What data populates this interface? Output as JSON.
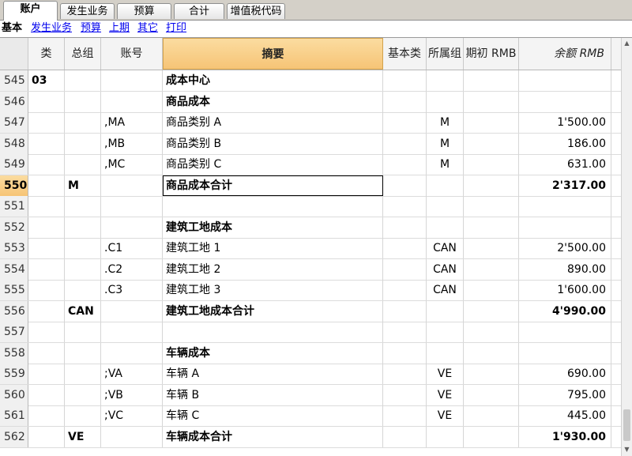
{
  "tabs": [
    {
      "label": "账户"
    },
    {
      "label": "发生业务"
    },
    {
      "label": "预算"
    },
    {
      "label": "合计"
    },
    {
      "label": "增值税代码"
    }
  ],
  "subnav": {
    "current": "基本",
    "links": [
      "发生业务",
      "预算",
      "上期",
      "其它",
      "打印"
    ]
  },
  "columns": [
    "类",
    "总组",
    "账号",
    "摘要",
    "基本类",
    "所属组",
    "期初 RMB",
    "余额 RMB"
  ],
  "rows": [
    {
      "num": "545",
      "cls": "03",
      "group": "",
      "acct": "",
      "desc": "成本中心",
      "base": "",
      "gr": "",
      "open": "",
      "bal": "",
      "bold": true
    },
    {
      "num": "546",
      "cls": "",
      "group": "",
      "acct": "",
      "desc": "商品成本",
      "base": "",
      "gr": "",
      "open": "",
      "bal": "",
      "bold": true
    },
    {
      "num": "547",
      "cls": "",
      "group": "",
      "acct": ",MA",
      "desc": "商品类别 A",
      "base": "",
      "gr": "M",
      "open": "",
      "bal": "1'500.00",
      "bold": false
    },
    {
      "num": "548",
      "cls": "",
      "group": "",
      "acct": ",MB",
      "desc": "商品类别 B",
      "base": "",
      "gr": "M",
      "open": "",
      "bal": "186.00",
      "bold": false
    },
    {
      "num": "549",
      "cls": "",
      "group": "",
      "acct": ",MC",
      "desc": "商品类别 C",
      "base": "",
      "gr": "M",
      "open": "",
      "bal": "631.00",
      "bold": false
    },
    {
      "num": "550",
      "cls": "",
      "group": "M",
      "acct": "",
      "desc": "商品成本合计",
      "base": "",
      "gr": "",
      "open": "",
      "bal": "2'317.00",
      "bold": true
    },
    {
      "num": "551",
      "cls": "",
      "group": "",
      "acct": "",
      "desc": "",
      "base": "",
      "gr": "",
      "open": "",
      "bal": "",
      "bold": false
    },
    {
      "num": "552",
      "cls": "",
      "group": "",
      "acct": "",
      "desc": "建筑工地成本",
      "base": "",
      "gr": "",
      "open": "",
      "bal": "",
      "bold": true
    },
    {
      "num": "553",
      "cls": "",
      "group": "",
      "acct": ".C1",
      "desc": "建筑工地 1",
      "base": "",
      "gr": "CAN",
      "open": "",
      "bal": "2'500.00",
      "bold": false
    },
    {
      "num": "554",
      "cls": "",
      "group": "",
      "acct": ".C2",
      "desc": "建筑工地 2",
      "base": "",
      "gr": "CAN",
      "open": "",
      "bal": "890.00",
      "bold": false
    },
    {
      "num": "555",
      "cls": "",
      "group": "",
      "acct": ".C3",
      "desc": "建筑工地 3",
      "base": "",
      "gr": "CAN",
      "open": "",
      "bal": "1'600.00",
      "bold": false
    },
    {
      "num": "556",
      "cls": "",
      "group": "CAN",
      "acct": "",
      "desc": "建筑工地成本合计",
      "base": "",
      "gr": "",
      "open": "",
      "bal": "4'990.00",
      "bold": true
    },
    {
      "num": "557",
      "cls": "",
      "group": "",
      "acct": "",
      "desc": "",
      "base": "",
      "gr": "",
      "open": "",
      "bal": "",
      "bold": false
    },
    {
      "num": "558",
      "cls": "",
      "group": "",
      "acct": "",
      "desc": "车辆成本",
      "base": "",
      "gr": "",
      "open": "",
      "bal": "",
      "bold": true
    },
    {
      "num": "559",
      "cls": "",
      "group": "",
      "acct": ";VA",
      "desc": "车辆 A",
      "base": "",
      "gr": "VE",
      "open": "",
      "bal": "690.00",
      "bold": false
    },
    {
      "num": "560",
      "cls": "",
      "group": "",
      "acct": ";VB",
      "desc": "车辆 B",
      "base": "",
      "gr": "VE",
      "open": "",
      "bal": "795.00",
      "bold": false
    },
    {
      "num": "561",
      "cls": "",
      "group": "",
      "acct": ";VC",
      "desc": "车辆 C",
      "base": "",
      "gr": "VE",
      "open": "",
      "bal": "445.00",
      "bold": false
    },
    {
      "num": "562",
      "cls": "",
      "group": "VE",
      "acct": "",
      "desc": "车辆成本合计",
      "base": "",
      "gr": "",
      "open": "",
      "bal": "1'930.00",
      "bold": true
    }
  ],
  "selected_row": "550",
  "icons": {
    "scroll_up": "scroll-up-arrow-icon",
    "scroll_down": "scroll-down-arrow-icon"
  }
}
